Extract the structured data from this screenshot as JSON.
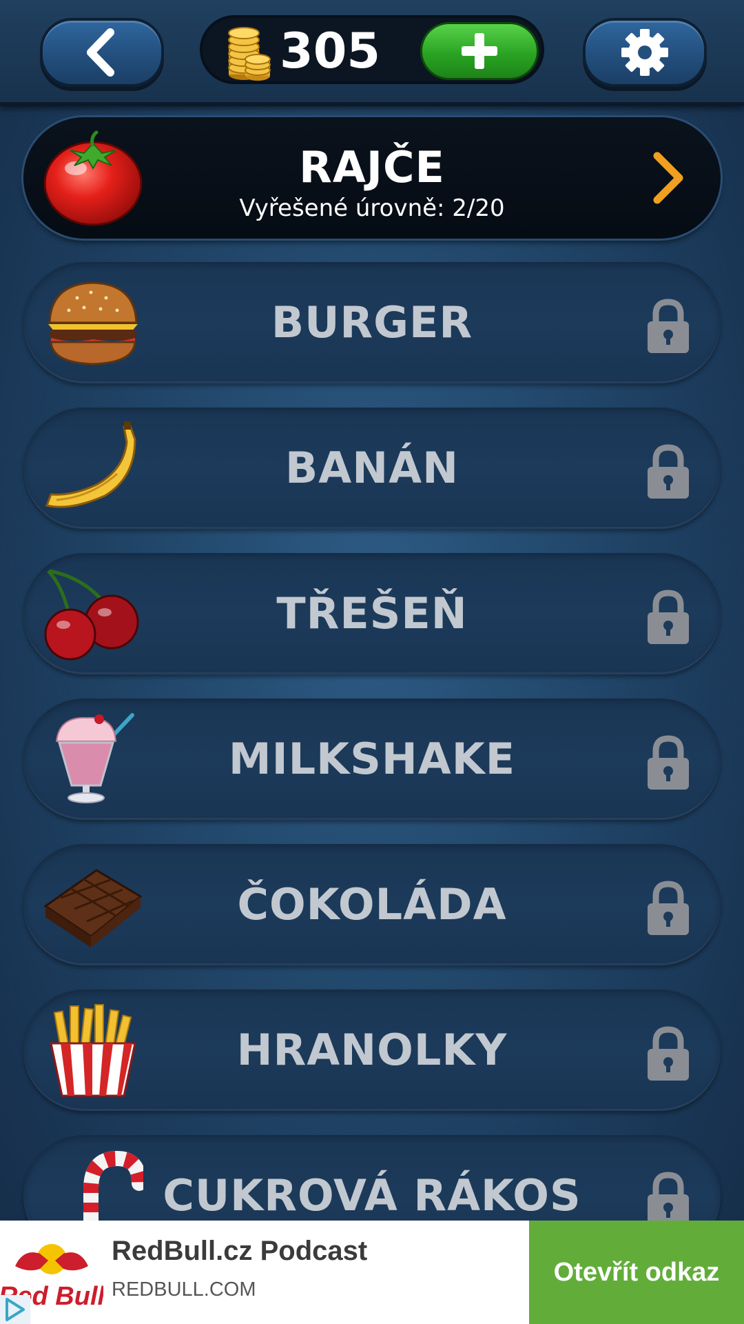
{
  "header": {
    "coins": "305",
    "back_icon": "chevron-left-icon",
    "settings_icon": "gear-icon",
    "add_icon": "plus-icon"
  },
  "categories": [
    {
      "name": "RAJČE",
      "progress": "Vyřešené úrovně: 2/20",
      "state": "unlocked",
      "icon": "tomato-icon"
    },
    {
      "name": "BURGER",
      "state": "locked",
      "icon": "burger-icon"
    },
    {
      "name": "BANÁN",
      "state": "locked",
      "icon": "banana-icon"
    },
    {
      "name": "TŘEŠEŇ",
      "state": "locked",
      "icon": "cherry-icon"
    },
    {
      "name": "MILKSHAKE",
      "state": "locked",
      "icon": "milkshake-icon"
    },
    {
      "name": "ČOKOLÁDA",
      "state": "locked",
      "icon": "chocolate-icon"
    },
    {
      "name": "HRANOLKY",
      "state": "locked",
      "icon": "fries-icon"
    },
    {
      "name": "CUKROVÁ RÁKOS",
      "state": "locked",
      "icon": "candy-cane-icon"
    }
  ],
  "ad": {
    "brand": "Red Bull",
    "title": "RedBull.cz Podcast",
    "domain": "REDBULL.COM",
    "cta": "Otevřít odkaz"
  },
  "colors": {
    "accent_orange": "#f0a020",
    "add_green": "#2aa423",
    "cta_green": "#62ad3a",
    "locked_text": "#c2c8d0"
  }
}
